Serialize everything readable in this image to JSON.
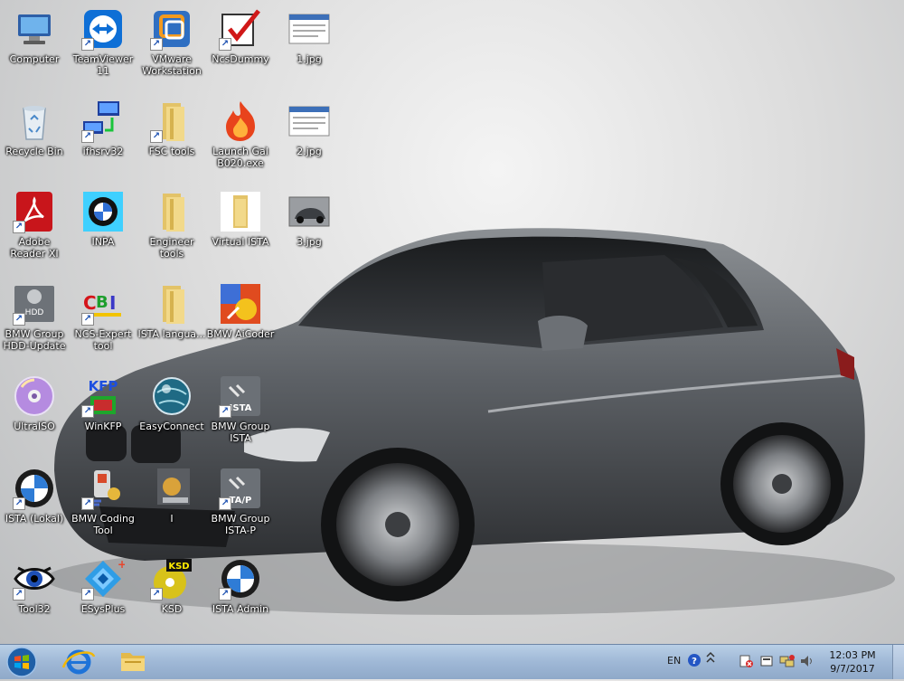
{
  "desktop": {
    "icons": [
      {
        "label": "Computer",
        "icon": "computer-icon"
      },
      {
        "label": "TeamViewer 11",
        "icon": "teamviewer-icon"
      },
      {
        "label": "VMware Workstation",
        "icon": "vmware-icon"
      },
      {
        "label": "NcsDummy",
        "icon": "ncsdummy-icon"
      },
      {
        "label": "1.jpg",
        "icon": "image-file-icon"
      },
      {
        "label": "Recycle Bin",
        "icon": "recycle-bin-icon"
      },
      {
        "label": "ifhsrv32",
        "icon": "ifhsrv-icon"
      },
      {
        "label": "FSC tools",
        "icon": "folder-icon"
      },
      {
        "label": "Launch Gal B020.exe",
        "icon": "flame-icon"
      },
      {
        "label": "2.jpg",
        "icon": "image-file-icon"
      },
      {
        "label": "Adobe Reader XI",
        "icon": "adobe-reader-icon"
      },
      {
        "label": "INPA",
        "icon": "inpa-icon"
      },
      {
        "label": "Engineer tools",
        "icon": "folder-icon"
      },
      {
        "label": "Virtual ISTA",
        "icon": "folder-icon"
      },
      {
        "label": "3.jpg",
        "icon": "car-image-icon"
      },
      {
        "label": "BMW Group HDD-Update",
        "icon": "hdd-update-icon"
      },
      {
        "label": "NCS-Expert tool",
        "icon": "ncs-expert-icon"
      },
      {
        "label": "ISTA langua...",
        "icon": "folder-icon"
      },
      {
        "label": "BMW AiCoder",
        "icon": "aicoder-icon"
      },
      {
        "label": "UltraISO",
        "icon": "disc-icon"
      },
      {
        "label": "WinKFP",
        "icon": "winkfp-icon"
      },
      {
        "label": "EasyConnect",
        "icon": "globe-icon"
      },
      {
        "label": "BMW Group ISTA",
        "icon": "ista-icon"
      },
      {
        "label": "ISTA (Lokal)",
        "icon": "bmw-logo-icon"
      },
      {
        "label": "BMW Coding Tool",
        "icon": "coding-tool-icon"
      },
      {
        "label": "I",
        "icon": "blurred-icon"
      },
      {
        "label": "BMW Group ISTA-P",
        "icon": "ista-p-icon"
      },
      {
        "label": "Tool32",
        "icon": "eye-icon"
      },
      {
        "label": "ESysPlus",
        "icon": "esys-icon"
      },
      {
        "label": "KSD",
        "icon": "ksd-icon"
      },
      {
        "label": "ISTA Admin",
        "icon": "bmw-logo-icon"
      }
    ]
  },
  "taskbar": {
    "start_label": "Start",
    "pinned": [
      {
        "name": "Internet Explorer",
        "icon": "internet-explorer-icon"
      },
      {
        "name": "Windows Explorer",
        "icon": "folder-icon"
      }
    ],
    "tray": {
      "language": "EN",
      "clock_time": "12:03 PM",
      "clock_date": "9/7/2017"
    }
  },
  "colors": {
    "taskbar": "#9fb8d6",
    "label_text": "#ffffff"
  }
}
